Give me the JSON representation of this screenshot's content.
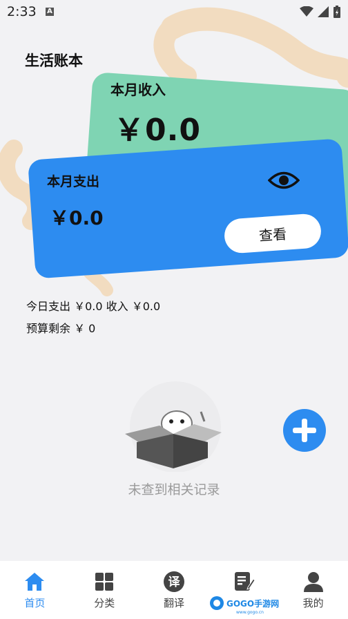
{
  "status_bar": {
    "time": "2:33",
    "notification_badge": "A"
  },
  "app": {
    "title": "生活账本"
  },
  "income_card": {
    "label": "本月收入",
    "value": "￥0.0",
    "color": "#7fd4b3"
  },
  "expense_card": {
    "label": "本月支出",
    "value": "￥0.0",
    "view_button": "查看",
    "color": "#2d8cf0"
  },
  "summary": {
    "today": "今日支出 ￥0.0  收入 ￥0.0",
    "budget": "预算剩余 ￥ 0"
  },
  "empty_state": {
    "text": "未查到相关记录"
  },
  "tabbar": {
    "tabs": [
      {
        "label": "首页",
        "icon": "home-icon",
        "active": true
      },
      {
        "label": "分类",
        "icon": "grid-icon",
        "active": false
      },
      {
        "label": "翻译",
        "icon": "translate-icon",
        "active": false
      },
      {
        "label": "",
        "icon": "note-edit-icon",
        "active": false
      },
      {
        "label": "我的",
        "icon": "person-icon",
        "active": false
      }
    ]
  },
  "watermark": {
    "brand": "GOGO手游网",
    "site": "www.gogo.cn"
  },
  "colors": {
    "accent": "#2d8cf0",
    "background": "#f2f2f4",
    "swirl": "#f2dcc0",
    "muted_text": "#9a9a9a"
  }
}
